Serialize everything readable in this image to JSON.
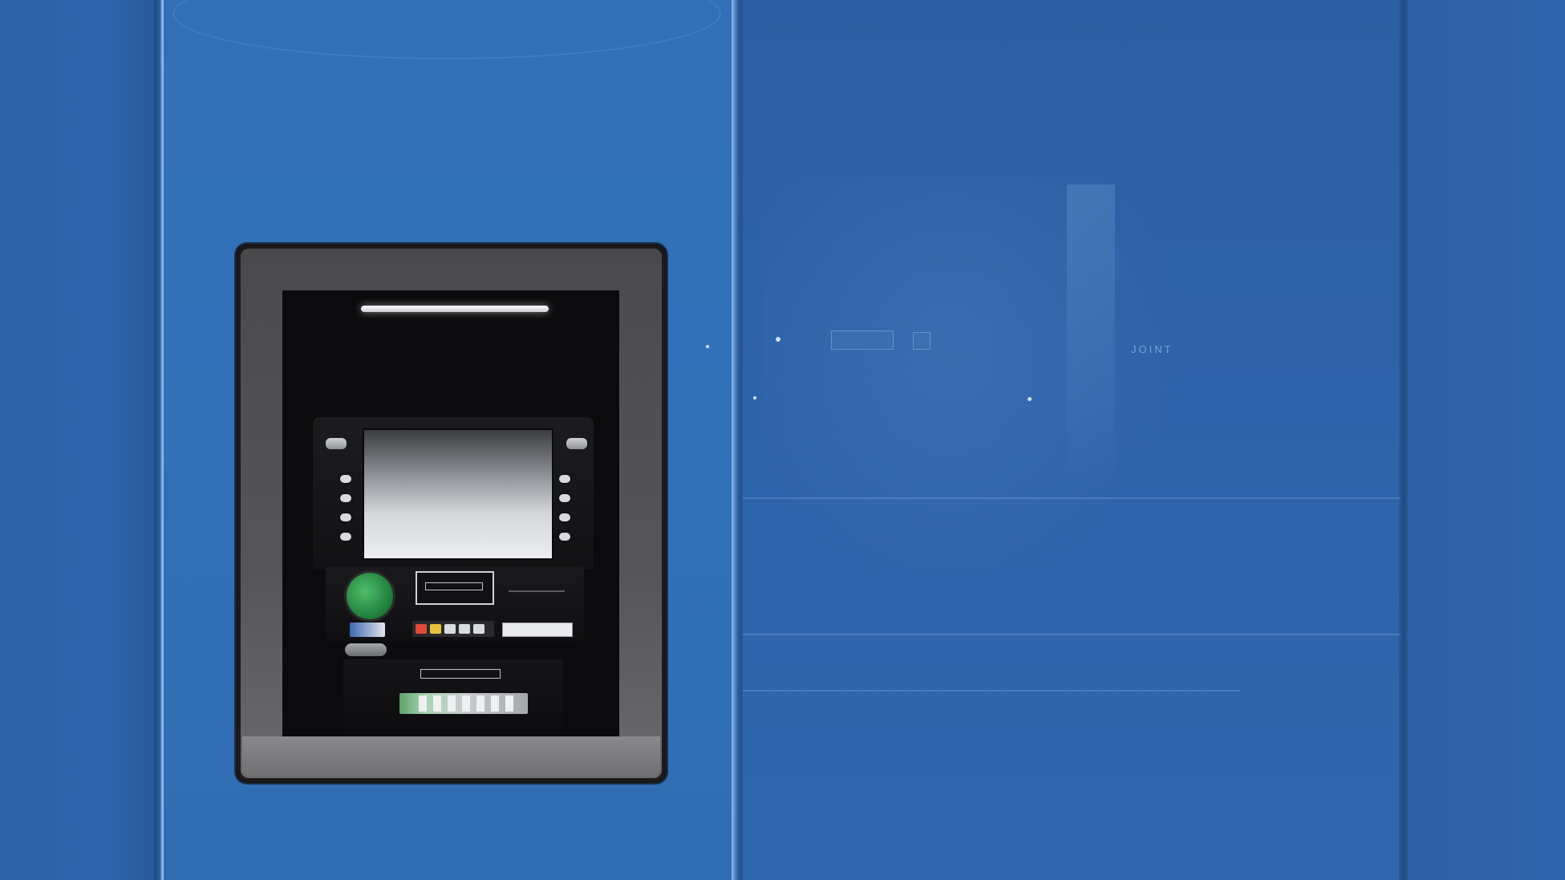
{
  "scene": {
    "description_colors": {
      "wall": "#2d63a8",
      "atm_frame": "#555557",
      "cavity": "#0b0b0d",
      "button_green": "#1d7a39"
    },
    "signs": {
      "mid_panel_text": "JOINT"
    }
  }
}
